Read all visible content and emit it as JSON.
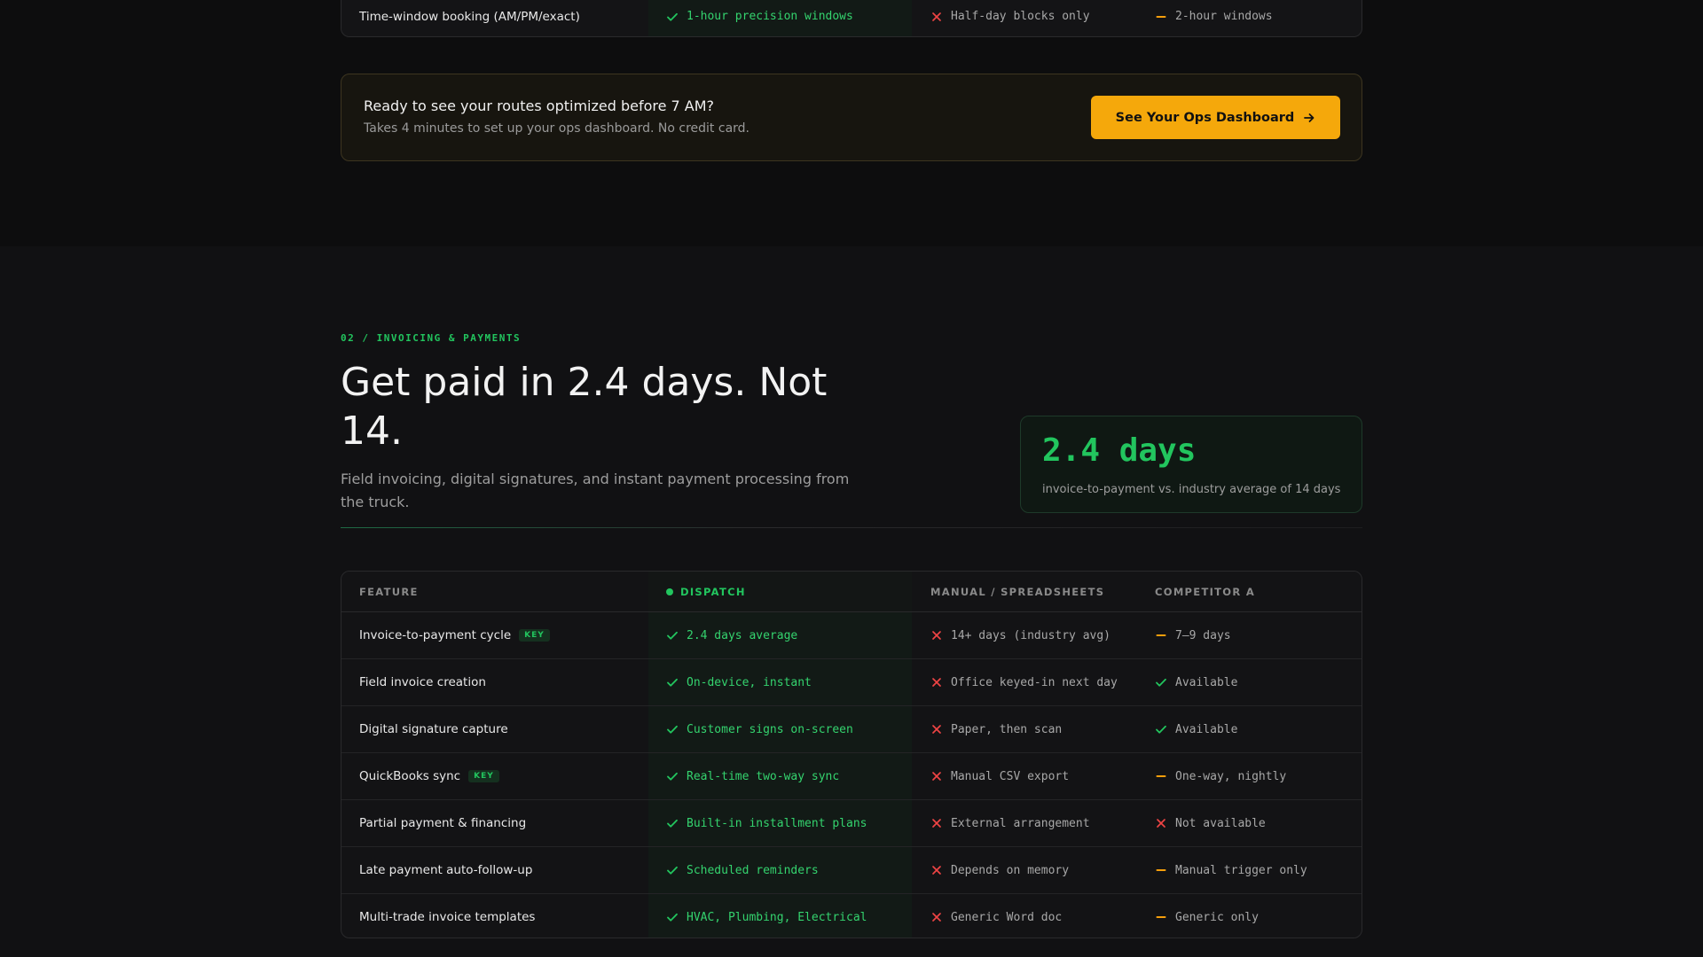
{
  "top_row": {
    "feature": "Time-window booking (AM/PM/exact)",
    "dispatch": {
      "status": "check",
      "text": "1-hour precision windows"
    },
    "manual": {
      "status": "cross",
      "text": "Half-day blocks only"
    },
    "competitor": {
      "status": "dash",
      "text": "2-hour windows"
    }
  },
  "cta": {
    "title": "Ready to see your routes optimized before 7 AM?",
    "subtitle": "Takes 4 minutes to set up your ops dashboard. No credit card.",
    "button_label": "See Your Ops Dashboard"
  },
  "section": {
    "eyebrow": "02 / INVOICING & PAYMENTS",
    "headline": "Get paid in 2.4 days. Not 14.",
    "subhead": "Field invoicing, digital signatures, and instant payment processing from the truck.",
    "stat_value": "2.4 days",
    "stat_caption": "invoice-to-payment vs. industry average of 14 days"
  },
  "table": {
    "headers": {
      "feature": "FEATURE",
      "dispatch": "DISPATCH",
      "manual": "MANUAL / SPREADSHEETS",
      "competitor": "COMPETITOR A"
    },
    "key_badge": "KEY",
    "rows": [
      {
        "feature": "Invoice-to-payment cycle",
        "key": true,
        "dispatch": {
          "status": "check",
          "text": "2.4 days average"
        },
        "manual": {
          "status": "cross",
          "text": "14+ days (industry avg)"
        },
        "competitor": {
          "status": "dash",
          "text": "7–9 days"
        }
      },
      {
        "feature": "Field invoice creation",
        "key": false,
        "dispatch": {
          "status": "check",
          "text": "On-device, instant"
        },
        "manual": {
          "status": "cross",
          "text": "Office keyed-in next day"
        },
        "competitor": {
          "status": "check",
          "text": "Available"
        }
      },
      {
        "feature": "Digital signature capture",
        "key": false,
        "dispatch": {
          "status": "check",
          "text": "Customer signs on-screen"
        },
        "manual": {
          "status": "cross",
          "text": "Paper, then scan"
        },
        "competitor": {
          "status": "check",
          "text": "Available"
        }
      },
      {
        "feature": "QuickBooks sync",
        "key": true,
        "dispatch": {
          "status": "check",
          "text": "Real-time two-way sync"
        },
        "manual": {
          "status": "cross",
          "text": "Manual CSV export"
        },
        "competitor": {
          "status": "dash",
          "text": "One-way, nightly"
        }
      },
      {
        "feature": "Partial payment & financing",
        "key": false,
        "dispatch": {
          "status": "check",
          "text": "Built-in installment plans"
        },
        "manual": {
          "status": "cross",
          "text": "External arrangement"
        },
        "competitor": {
          "status": "cross",
          "text": "Not available"
        }
      },
      {
        "feature": "Late payment auto-follow-up",
        "key": false,
        "dispatch": {
          "status": "check",
          "text": "Scheduled reminders"
        },
        "manual": {
          "status": "cross",
          "text": "Depends on memory"
        },
        "competitor": {
          "status": "dash",
          "text": "Manual trigger only"
        }
      },
      {
        "feature": "Multi-trade invoice templates",
        "key": false,
        "dispatch": {
          "status": "check",
          "text": "HVAC, Plumbing, Electrical"
        },
        "manual": {
          "status": "cross",
          "text": "Generic Word doc"
        },
        "competitor": {
          "status": "dash",
          "text": "Generic only"
        }
      }
    ]
  },
  "colors": {
    "accent_green": "#22c55e",
    "cross_red": "#ef4444",
    "dash_amber": "#f59e0b",
    "cta_button": "#f5a80b"
  }
}
